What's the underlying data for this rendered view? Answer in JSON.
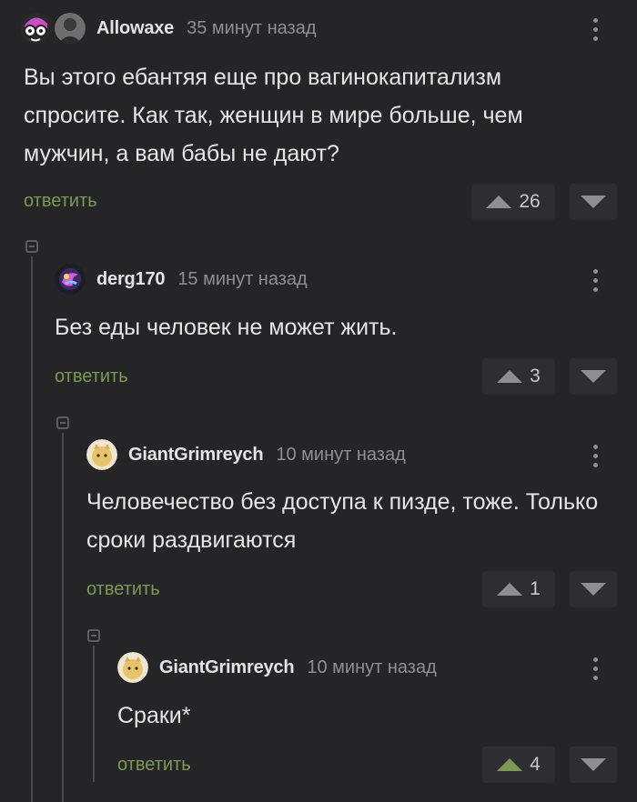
{
  "comments": [
    {
      "author": "Allowaxe",
      "time": "35 минут назад",
      "text": "Вы этого ебантяя еще про вагинокапитализм спросите. Как так, женщин в мире больше, чем мужчин, а вам бабы не дают?",
      "reply_label": "ответить",
      "rating": "26",
      "upvoted": false
    },
    {
      "author": "derg170",
      "time": "15 минут назад",
      "text": "Без еды человек не может жить.",
      "reply_label": "ответить",
      "rating": "3",
      "upvoted": false
    },
    {
      "author": "GiantGrimreych",
      "time": "10 минут назад",
      "text": "Человечество без доступа к пизде, тоже. Только сроки раздвигаются",
      "reply_label": "ответить",
      "rating": "1",
      "upvoted": false
    },
    {
      "author": "GiantGrimreych",
      "time": "10 минут назад",
      "text": "Сраки*",
      "reply_label": "ответить",
      "rating": "4",
      "upvoted": true
    }
  ],
  "colors": {
    "background": "#252528",
    "reply": "#7a9a54",
    "upvote_active": "#7a9a54",
    "muted": "#8f8f93"
  }
}
